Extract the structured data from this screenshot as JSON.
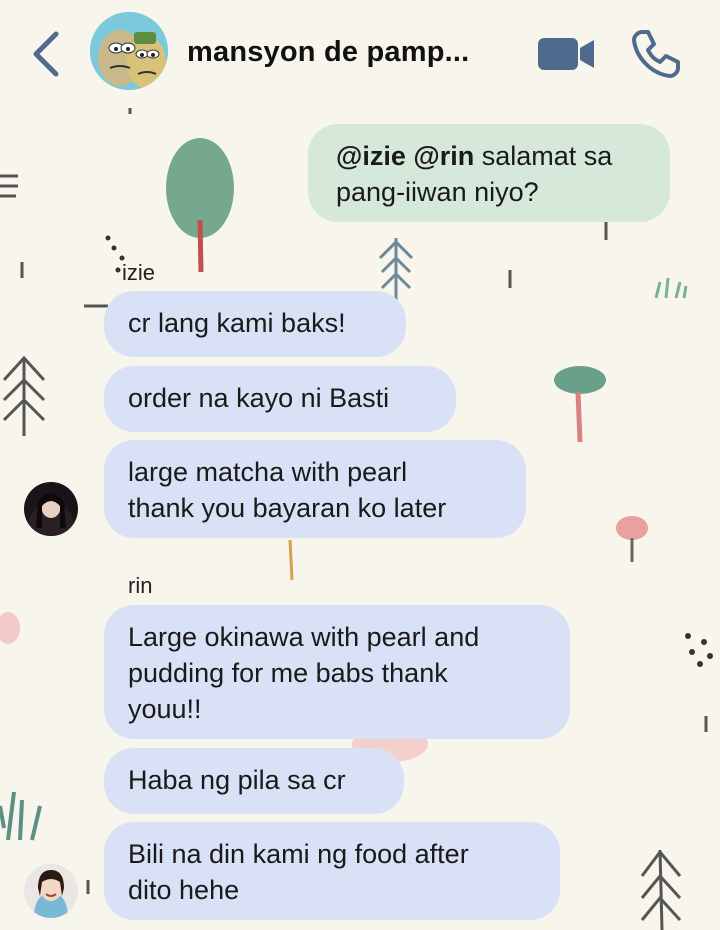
{
  "header": {
    "title": "mansyon de pamp...",
    "back_icon": "chevron-left-icon",
    "video_icon": "video-camera-icon",
    "call_icon": "phone-icon",
    "accent": "#4e6a8c"
  },
  "colors": {
    "incoming_bubble": "#d9e1f6",
    "outgoing_bubble": "#d5e8d9",
    "background": "#f8f5ec"
  },
  "messages": {
    "m0": {
      "mention1": "@izie",
      "mention2": "@rin",
      "line1_rest": " salamat sa",
      "line2": "pang-iiwan niyo?"
    },
    "izie_name": "izie",
    "m1": "cr lang kami baks!",
    "m2": "order na kayo ni Basti",
    "m3_line1": "large matcha with pearl",
    "m3_line2": "thank you bayaran ko later",
    "rin_name": "rin",
    "m4_line1": "Large okinawa with pearl and",
    "m4_line2": "pudding for me babs thank",
    "m4_line3": "youu!!",
    "m5": "Haba ng pila sa cr",
    "m6_line1": "Bili na din kami ng food after",
    "m6_line2": "dito hehe"
  }
}
